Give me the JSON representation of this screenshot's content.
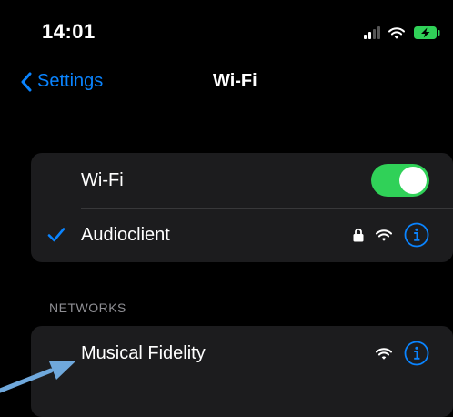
{
  "status_bar": {
    "time": "14:01",
    "icons": [
      "signal-icon",
      "wifi-icon",
      "battery-charging-icon"
    ]
  },
  "nav": {
    "back_label": "Settings",
    "title": "Wi-Fi"
  },
  "wifi_group": {
    "toggle_label": "Wi-Fi",
    "toggle_on": true,
    "connected_network": {
      "name": "Audioclient",
      "secured": true,
      "icons": [
        "checkmark-icon",
        "lock-icon",
        "wifi-icon",
        "info-icon"
      ]
    }
  },
  "networks": {
    "header": "NETWORKS",
    "items": [
      {
        "name": "Musical Fidelity",
        "icons": [
          "wifi-icon",
          "info-icon"
        ]
      }
    ]
  },
  "colors": {
    "accent": "#0a84ff",
    "toggle_on": "#30d158",
    "group_bg": "#1c1c1e",
    "secondary_text": "#8e8e93",
    "annotation_arrow": "#6fa8dc"
  }
}
